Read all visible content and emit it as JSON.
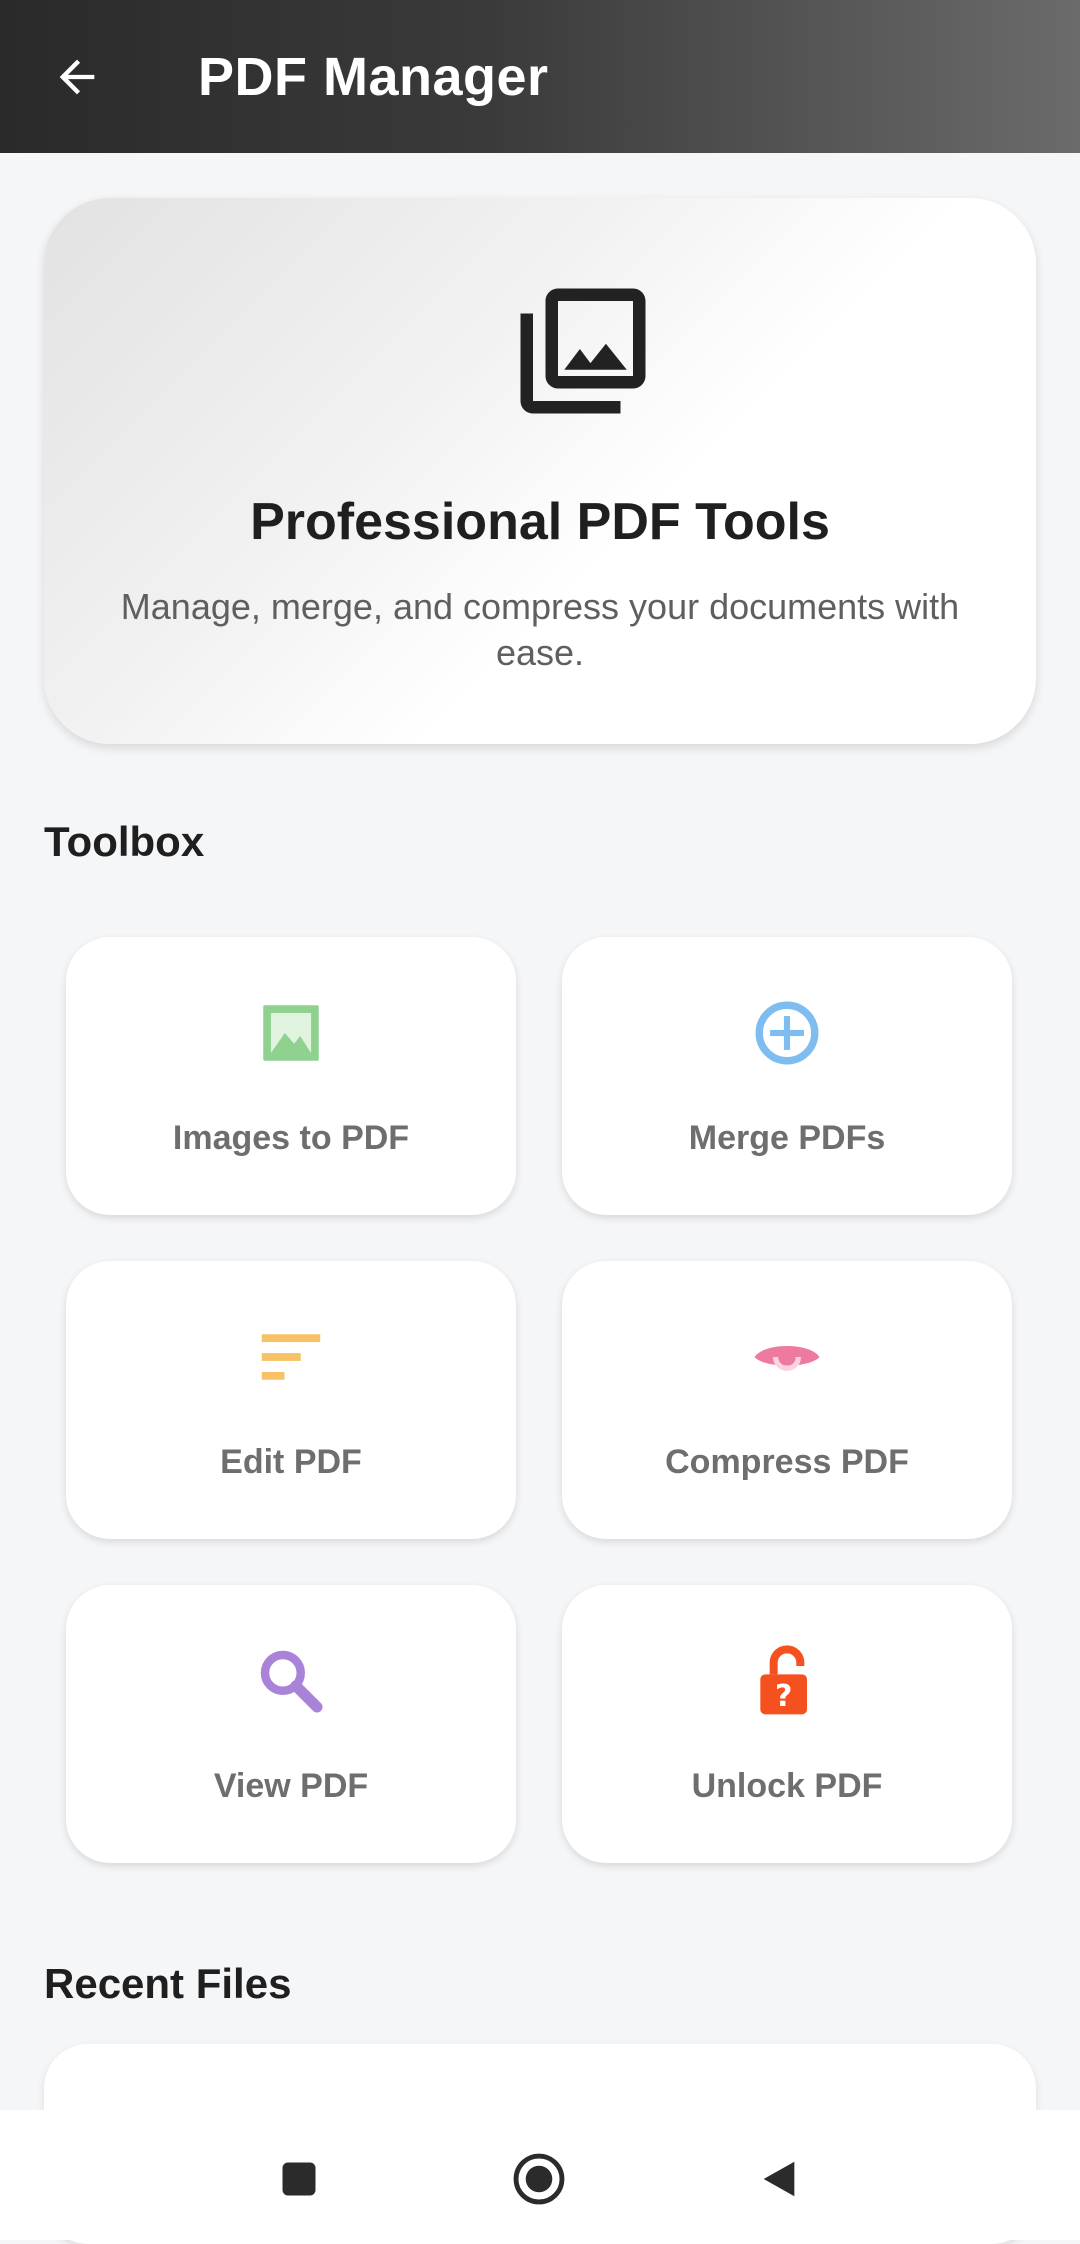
{
  "app_bar": {
    "title": "PDF Manager",
    "back_icon": "arrow-left-icon"
  },
  "hero": {
    "icon": "photo-library-icon",
    "title": "Professional PDF Tools",
    "subtitle": "Manage, merge, and compress your documents with ease."
  },
  "toolbox": {
    "title": "Toolbox",
    "tools": [
      {
        "label": "Images to PDF",
        "icon": "image-icon",
        "color": "#8fd18f"
      },
      {
        "label": "Merge PDFs",
        "icon": "add-circle-icon",
        "color": "#7fbdf0"
      },
      {
        "label": "Edit PDF",
        "icon": "sort-lines-icon",
        "color": "#f7c266"
      },
      {
        "label": "Compress PDF",
        "icon": "eye-icon",
        "color": "#ee7aa0"
      },
      {
        "label": "View PDF",
        "icon": "search-icon",
        "color": "#a983d8"
      },
      {
        "label": "Unlock PDF",
        "icon": "unlock-question-icon",
        "color": "#f4511e"
      }
    ]
  },
  "recent": {
    "title": "Recent Files"
  },
  "nav": {
    "recents_icon": "square-icon",
    "home_icon": "circle-home-icon",
    "back_icon": "triangle-back-icon"
  }
}
